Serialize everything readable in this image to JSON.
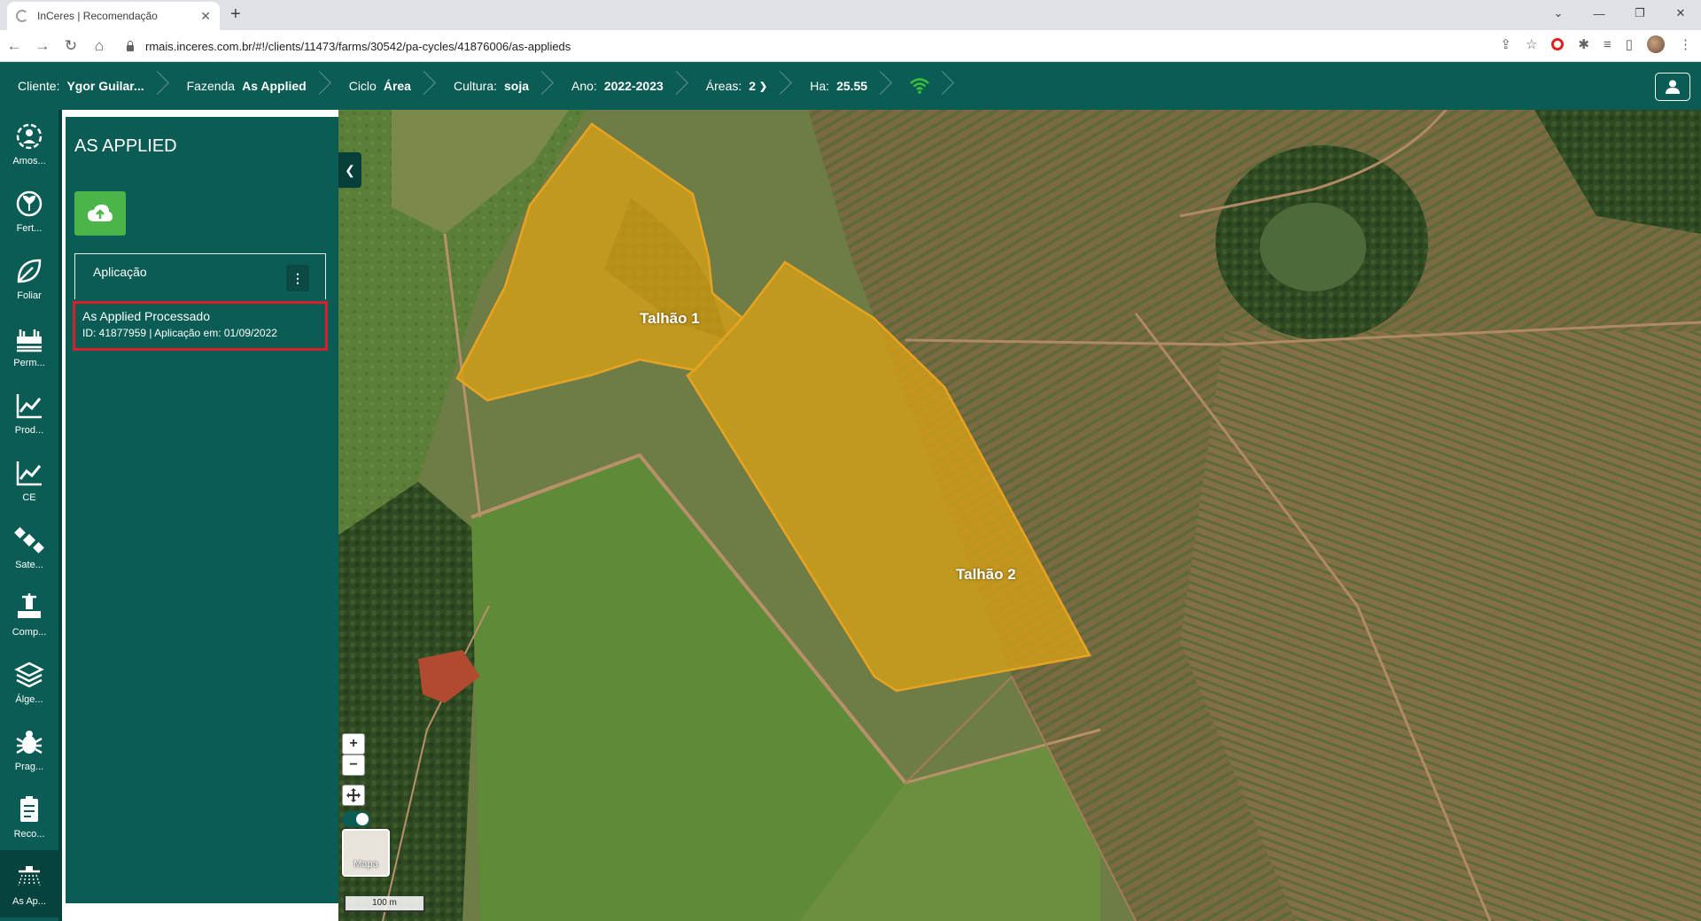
{
  "browser": {
    "tab_title": "InCeres | Recomendação",
    "url": "rmais.inceres.com.br/#!/clients/11473/farms/30542/pa-cycles/41876006/as-applieds"
  },
  "header": {
    "cliente_label": "Cliente:",
    "cliente_value": "Ygor Guilar...",
    "fazenda_label": "Fazenda",
    "fazenda_value": "As Applied",
    "ciclo_label": "Ciclo",
    "ciclo_value": "Área",
    "cultura_label": "Cultura:",
    "cultura_value": "soja",
    "ano_label": "Ano:",
    "ano_value": "2022-2023",
    "areas_label": "Áreas:",
    "areas_value": "2",
    "ha_label": "Ha:",
    "ha_value": "25.55",
    "wifi_color": "#3ec13a"
  },
  "rail": {
    "items": [
      {
        "label": "Amos...",
        "icon": "sampling-icon"
      },
      {
        "label": "Fert...",
        "icon": "fertility-icon"
      },
      {
        "label": "Foliar",
        "icon": "leaf-icon"
      },
      {
        "label": "Perm...",
        "icon": "permission-icon"
      },
      {
        "label": "Prod...",
        "icon": "productivity-chart-icon"
      },
      {
        "label": "CE",
        "icon": "ce-chart-icon"
      },
      {
        "label": "Sate...",
        "icon": "satellite-icon"
      },
      {
        "label": "Comp...",
        "icon": "compaction-icon"
      },
      {
        "label": "Álge...",
        "icon": "layers-icon"
      },
      {
        "label": "Prag...",
        "icon": "bug-icon"
      },
      {
        "label": "Reco...",
        "icon": "recommendation-icon"
      },
      {
        "label": "As Ap...",
        "icon": "sprayer-icon"
      }
    ]
  },
  "panel": {
    "title": "AS APPLIED",
    "card_title": "Aplicação",
    "result_title": "As Applied Processado",
    "result_meta": "ID: 41877959 | Aplicação em: 01/09/2022"
  },
  "map": {
    "field1_label": "Talhão 1",
    "field2_label": "Talhão 2",
    "basemap_label": "Mapa",
    "scale_label": "100 m",
    "field_color": "#d4a017"
  }
}
